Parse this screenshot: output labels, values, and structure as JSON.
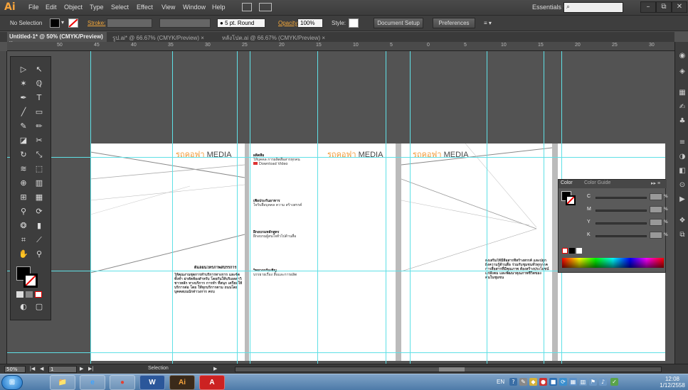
{
  "app": {
    "logo": "Ai"
  },
  "menu": [
    "File",
    "Edit",
    "Object",
    "Type",
    "Select",
    "Effect",
    "View",
    "Window",
    "Help"
  ],
  "workspace": "Essentials",
  "window_controls": {
    "minimize": "–",
    "restore": "⧉",
    "close": "✕"
  },
  "control_bar": {
    "selection_status": "No Selection",
    "stroke_label": "Stroke:",
    "brush": "5 pt. Round",
    "opacity_label": "Opacity:",
    "opacity_value": "100%",
    "style_label": "Style:",
    "document_setup": "Document Setup",
    "preferences": "Preferences"
  },
  "tabs": [
    {
      "label": "Untitled-1* @ 50% (CMYK/Preview)",
      "close": "×",
      "active": true
    },
    {
      "label": "รูป.ai* @ 66.67% (CMYK/Preview)",
      "close": "×",
      "active": false
    },
    {
      "label": "หลังโปต.ai @ 66.67% (CMYK/Preview)",
      "close": "×",
      "active": false
    }
  ],
  "ruler_ticks": [
    "50",
    "45",
    "40",
    "35",
    "30",
    "25",
    "20",
    "15",
    "10",
    "5",
    "0",
    "5",
    "10",
    "15",
    "20",
    "25",
    "30",
    "35"
  ],
  "artboard": {
    "logo_main": "MEDIA",
    "logo_accent": "รถคอฟา",
    "panel1_heading": "ดีแลยนโทรภาพสปรรการ",
    "panel1_body": "ให้คุณงานชุดการทำบริการทางการ และจัดทั้งทำ ผ่าตัดห้องสำหรับ โดยกันให้บริเอลสาวิชาวหลัก ทางบริการ การทำ ที่สนุก เตรียมให้บริการต่อ โดย ให้ทุกบริการตาม ถนนโดยบุคคลบนนักท่าวงการ ครบ",
    "panel2_sections": [
      {
        "heading": "ผลิตสื่อ",
        "sub": "ให้บุคคล การผลิตสื่อสารทุกคน"
      },
      {
        "heading": "เพื่อประกันอาหาร",
        "sub": "ใจรับสื่อบุคคล ความ สร้างสรรค์"
      },
      {
        "heading": "ฝึกอบรมหลักสูตร",
        "sub": "ฝึกอบรมผู้สนใจทั่วไปด้านสื่อ"
      },
      {
        "heading": "วิทยากรรับเชิญ",
        "sub": "บรรยายเรื่อง สื่อและการผลิต"
      }
    ],
    "panel2_badge": "Download Video",
    "panel3_body": "ส่งเสริมให้มีสื่อสารที่สร้างสรรค์ และปลูกฝังความรู้ด้านสื่อ ร่วมกับชุมชนทั่วทุกภาค การสื่อสารที่มีคุณภาพ ต้องสร้างประโยชน์แก่สังคม และพัฒนาคุณภาพชีวิตของคนในชุมชน"
  },
  "color_panel": {
    "tab_color": "Color",
    "tab_guide": "Color Guide",
    "channels": [
      {
        "label": "C"
      },
      {
        "label": "M"
      },
      {
        "label": "Y"
      },
      {
        "label": "K"
      }
    ],
    "pct": "%"
  },
  "status_bar": {
    "zoom": "50%",
    "artboard_num": "1",
    "tool_status": "Selection"
  },
  "taskbar": {
    "apps": [
      {
        "name": "file-explorer",
        "glyph": "📁",
        "color": "#f2c14e"
      },
      {
        "name": "internet-explorer",
        "glyph": "e",
        "color": "#3ea3ff"
      },
      {
        "name": "chrome",
        "glyph": "●",
        "color": "#e34133"
      },
      {
        "name": "word",
        "glyph": "W",
        "color": "#2b579a"
      },
      {
        "name": "illustrator",
        "glyph": "Ai",
        "color": "#f7a43c"
      },
      {
        "name": "acrobat",
        "glyph": "A",
        "color": "#e22b2b"
      }
    ],
    "language": "EN",
    "time": "12:08",
    "date": "1/12/2558"
  },
  "colors": {
    "guide": "#5fe0e6",
    "accent_orange": "#f29b3a",
    "ui_dark": "#3d3d3d",
    "canvas": "#535353"
  }
}
